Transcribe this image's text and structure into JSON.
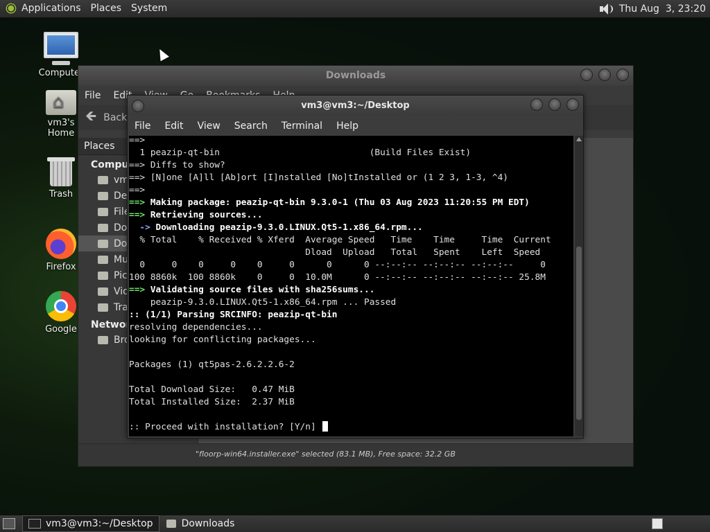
{
  "top_panel": {
    "menus": [
      "Applications",
      "Places",
      "System"
    ],
    "clock": "Thu Aug  3, 23:20",
    "icons": [
      "apps-logo-icon",
      "speaker-icon"
    ]
  },
  "desktop_icons": [
    {
      "label": "Computer",
      "icon": "computer-icon"
    },
    {
      "label": "vm3's Home",
      "icon": "home-folder-icon"
    },
    {
      "label": "Trash",
      "icon": "trash-icon"
    },
    {
      "label": "Firefox",
      "icon": "firefox-icon"
    },
    {
      "label": "Google",
      "icon": "chrome-icon"
    }
  ],
  "file_manager": {
    "title": "Downloads",
    "menu": [
      "File",
      "Edit",
      "View",
      "Go",
      "Bookmarks",
      "Help"
    ],
    "back_label": "Back",
    "places_header": "Places",
    "category_computer": "Computer",
    "category_network": "Network",
    "sidebar_items": [
      "vm3",
      "Desktop",
      "File System",
      "Documents",
      "Downloads",
      "Music",
      "Pictures",
      "Videos",
      "Trash"
    ],
    "network_items": [
      "Browse Network"
    ],
    "status": "\"floorp-win64.installer.exe\" selected (83.1 MB), Free space: 32.2 GB"
  },
  "terminal": {
    "title": "vm3@vm3:~/Desktop",
    "menu": [
      "File",
      "Edit",
      "View",
      "Search",
      "Terminal",
      "Help"
    ],
    "lines": [
      {
        "text": "==>",
        "style": "normal"
      },
      {
        "text": "  1 peazip-qt-bin                            (Build Files Exist)",
        "style": "normal"
      },
      {
        "text": "==> Diffs to show?",
        "style": "normal"
      },
      {
        "text": "==> [N]one [A]ll [Ab]ort [I]nstalled [No]tInstalled or (1 2 3, 1-3, ^4)",
        "style": "normal"
      },
      {
        "text": "==>",
        "style": "normal"
      },
      {
        "prefix": "==>",
        "text": " Making package: peazip-qt-bin 9.3.0-1 (Thu 03 Aug 2023 11:20:55 PM EDT)",
        "style": "green-bold"
      },
      {
        "prefix": "==>",
        "text": " Retrieving sources...",
        "style": "green-bold"
      },
      {
        "prefix": "  ->",
        "text": " Downloading peazip-9.3.0.LINUX.Qt5-1.x86_64.rpm...",
        "style": "blue-bold"
      },
      {
        "text": "  % Total    % Received % Xferd  Average Speed   Time    Time     Time  Current",
        "style": "normal"
      },
      {
        "text": "                                 Dload  Upload   Total   Spent    Left  Speed",
        "style": "normal"
      },
      {
        "text": "  0     0    0     0    0     0      0      0 --:--:-- --:--:-- --:--:--     0",
        "style": "normal"
      },
      {
        "text": "100 8860k  100 8860k    0     0  10.0M      0 --:--:-- --:--:-- --:--:-- 25.8M",
        "style": "normal"
      },
      {
        "prefix": "==>",
        "text": " Validating source files with sha256sums...",
        "style": "green-bold"
      },
      {
        "text": "    peazip-9.3.0.LINUX.Qt5-1.x86_64.rpm ... Passed",
        "style": "normal"
      },
      {
        "text": ":: (1/1) Parsing SRCINFO: peazip-qt-bin",
        "style": "bold"
      },
      {
        "text": "resolving dependencies...",
        "style": "normal"
      },
      {
        "text": "looking for conflicting packages...",
        "style": "normal"
      },
      {
        "text": "",
        "style": "normal"
      },
      {
        "text": "Packages (1) qt5pas-2.6.2.2.6-2",
        "style": "normal"
      },
      {
        "text": "",
        "style": "normal"
      },
      {
        "text": "Total Download Size:   0.47 MiB",
        "style": "normal"
      },
      {
        "text": "Total Installed Size:  2.37 MiB",
        "style": "normal"
      },
      {
        "text": "",
        "style": "normal"
      },
      {
        "text": ":: Proceed with installation? [Y/n] ",
        "style": "prompt"
      }
    ]
  },
  "bottom_panel": {
    "tasks": [
      {
        "label": "vm3@vm3:~/Desktop",
        "active": true
      },
      {
        "label": "Downloads",
        "active": false
      }
    ]
  }
}
